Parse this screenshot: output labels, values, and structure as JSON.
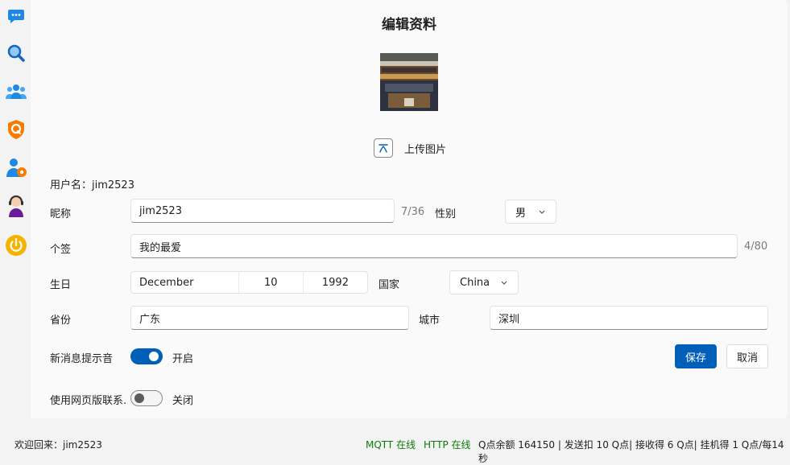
{
  "sidebar": {
    "items": [
      {
        "name": "chat-icon",
        "color": "#1e88e5"
      },
      {
        "name": "search-icon",
        "color": "#1565c0"
      },
      {
        "name": "group-icon",
        "color": "#1e88e5"
      },
      {
        "name": "shield-q-icon",
        "color": "#f57c00"
      },
      {
        "name": "user-settings-icon",
        "color": "#1e88e5"
      },
      {
        "name": "support-agent-icon",
        "color": "#6a1b9a"
      },
      {
        "name": "power-icon",
        "color": "#f5b300"
      }
    ]
  },
  "form": {
    "title": "编辑资料",
    "upload_label": "上传图片",
    "username_text": "用户名：jim2523",
    "nickname_label": "昵称",
    "nickname_value": "jim2523",
    "nickname_count": "7/36",
    "gender_label": "性别",
    "gender_value": "男",
    "signature_label": "个签",
    "signature_value": "我的最爱",
    "signature_count": "4/80",
    "birthday_label": "生日",
    "birth_month": "December",
    "birth_day": "10",
    "birth_year": "1992",
    "country_label": "国家",
    "country_value": "China",
    "province_label": "省份",
    "province_value": "广东",
    "city_label": "城市",
    "city_value": "深圳",
    "notify_label": "新消息提示音",
    "notify_state": "开启",
    "notify_on": true,
    "web_contact_label": "使用网页版联系.",
    "web_contact_state": "关闭",
    "web_contact_on": false,
    "save_label": "保存",
    "cancel_label": "取消"
  },
  "status": {
    "welcome": "欢迎回来：jim2523",
    "mqtt": "MQTT 在线",
    "http": "HTTP 在线",
    "points": "Q点余额 164150 | 发送扣 10 Q点| 接收得 6 Q点| 挂机得 1 Q点/每14秒"
  },
  "colors": {
    "accent": "#005fb8",
    "online": "#0e7a0d"
  }
}
